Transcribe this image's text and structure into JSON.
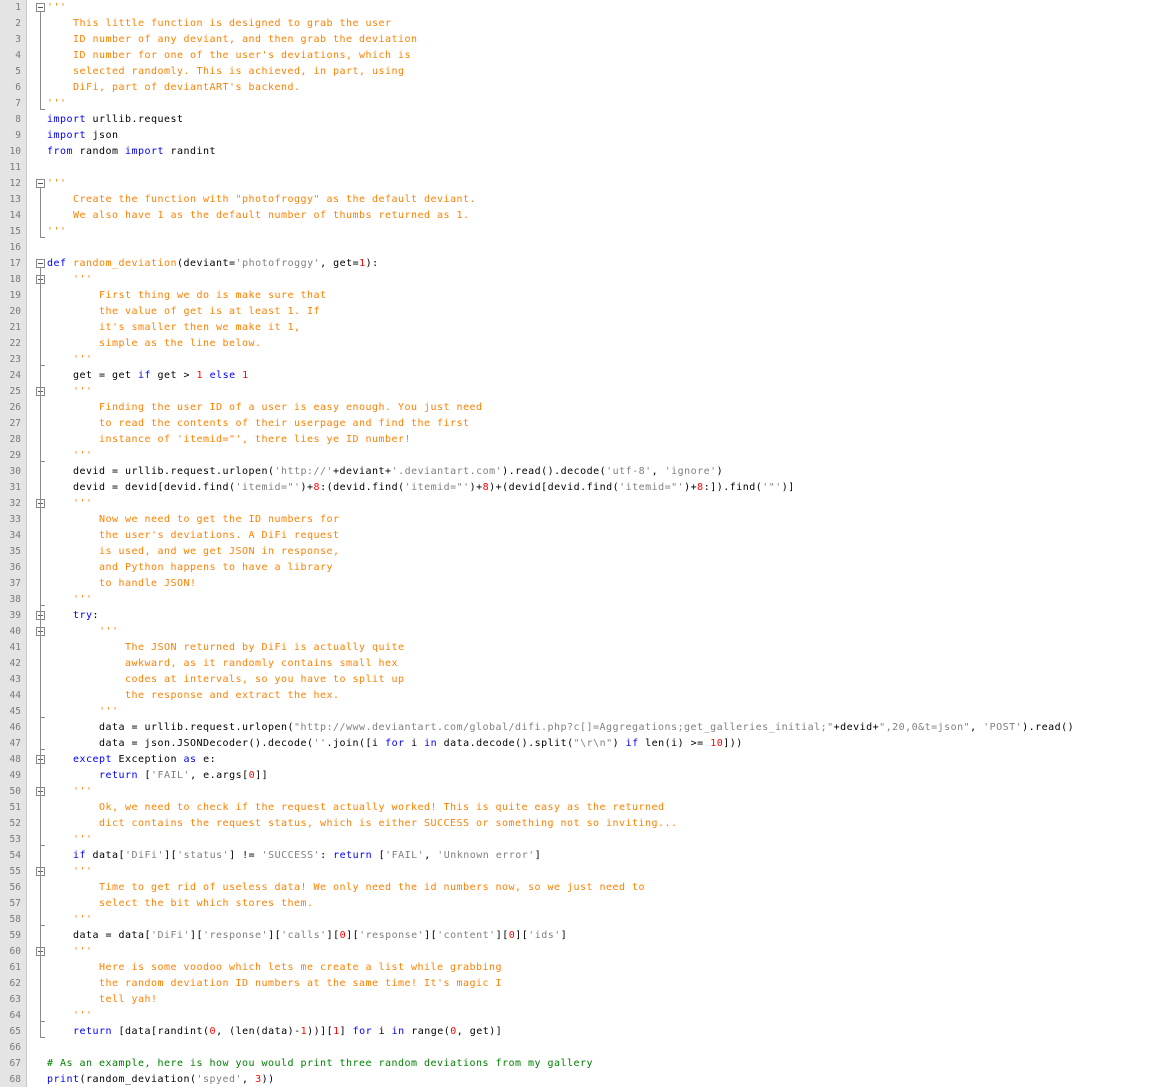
{
  "editor": {
    "colors": {
      "keyword": "#0000ff",
      "string": "#808080",
      "comment_string": "#ff8000",
      "number": "#ff0000",
      "comment": "#008000",
      "default": "#000000"
    },
    "lines": [
      {
        "n": "1",
        "t": [
          [
            "ds",
            "'''"
          ]
        ]
      },
      {
        "n": "2",
        "t": [
          [
            "ds",
            "    This little function is designed to grab the user"
          ]
        ]
      },
      {
        "n": "3",
        "t": [
          [
            "ds",
            "    ID number of any deviant, and then grab the deviation"
          ]
        ]
      },
      {
        "n": "4",
        "t": [
          [
            "ds",
            "    ID number for one of the user's deviations, which is"
          ]
        ]
      },
      {
        "n": "5",
        "t": [
          [
            "ds",
            "    selected randomly. This is achieved, in part, using"
          ]
        ]
      },
      {
        "n": "6",
        "t": [
          [
            "ds",
            "    DiFi, part of deviantART's backend."
          ]
        ]
      },
      {
        "n": "7",
        "t": [
          [
            "ds",
            "'''"
          ]
        ]
      },
      {
        "n": "8",
        "t": [
          [
            "kw",
            "import"
          ],
          [
            "d",
            " urllib.request"
          ]
        ]
      },
      {
        "n": "9",
        "t": [
          [
            "kw",
            "import"
          ],
          [
            "d",
            " json"
          ]
        ]
      },
      {
        "n": "10",
        "t": [
          [
            "kw",
            "from"
          ],
          [
            "d",
            " random "
          ],
          [
            "kw",
            "import"
          ],
          [
            "d",
            " randint"
          ]
        ]
      },
      {
        "n": "11",
        "t": []
      },
      {
        "n": "12",
        "t": [
          [
            "ds",
            "'''"
          ]
        ]
      },
      {
        "n": "13",
        "t": [
          [
            "ds",
            "    Create the function with \"photofroggy\" as the default deviant."
          ]
        ]
      },
      {
        "n": "14",
        "t": [
          [
            "ds",
            "    We also have 1 as the default number of thumbs returned as 1."
          ]
        ]
      },
      {
        "n": "15",
        "t": [
          [
            "ds",
            "'''"
          ]
        ]
      },
      {
        "n": "16",
        "t": []
      },
      {
        "n": "17",
        "t": [
          [
            "kw",
            "def"
          ],
          [
            "d",
            " "
          ],
          [
            "fn",
            "random_deviation"
          ],
          [
            "d",
            "(deviant="
          ],
          [
            "s",
            "'photofroggy'"
          ],
          [
            "d",
            ", get="
          ],
          [
            "num",
            "1"
          ],
          [
            "d",
            "):"
          ]
        ]
      },
      {
        "n": "18",
        "t": [
          [
            "d",
            "    "
          ],
          [
            "ds",
            "'''"
          ]
        ]
      },
      {
        "n": "19",
        "t": [
          [
            "ds",
            "        First thing we do is make sure that"
          ]
        ]
      },
      {
        "n": "20",
        "t": [
          [
            "ds",
            "        the value of get is at least 1. If"
          ]
        ]
      },
      {
        "n": "21",
        "t": [
          [
            "ds",
            "        it's smaller then we make it 1,"
          ]
        ]
      },
      {
        "n": "22",
        "t": [
          [
            "ds",
            "        simple as the line below."
          ]
        ]
      },
      {
        "n": "23",
        "t": [
          [
            "ds",
            "    '''"
          ]
        ]
      },
      {
        "n": "24",
        "t": [
          [
            "d",
            "    get = get "
          ],
          [
            "kw",
            "if"
          ],
          [
            "d",
            " get > "
          ],
          [
            "num",
            "1"
          ],
          [
            "d",
            " "
          ],
          [
            "kw",
            "else"
          ],
          [
            "d",
            " "
          ],
          [
            "num",
            "1"
          ]
        ]
      },
      {
        "n": "25",
        "t": [
          [
            "d",
            "    "
          ],
          [
            "ds",
            "'''"
          ]
        ]
      },
      {
        "n": "26",
        "t": [
          [
            "ds",
            "        Finding the user ID of a user is easy enough. You just need"
          ]
        ]
      },
      {
        "n": "27",
        "t": [
          [
            "ds",
            "        to read the contents of their userpage and find the first"
          ]
        ]
      },
      {
        "n": "28",
        "t": [
          [
            "ds",
            "        instance of 'itemid=\"', there lies ye ID number!"
          ]
        ]
      },
      {
        "n": "29",
        "t": [
          [
            "ds",
            "    '''"
          ]
        ]
      },
      {
        "n": "30",
        "t": [
          [
            "d",
            "    devid = urllib.request.urlopen("
          ],
          [
            "s",
            "'http://'"
          ],
          [
            "d",
            "+deviant+"
          ],
          [
            "s",
            "'.deviantart.com'"
          ],
          [
            "d",
            ").read().decode("
          ],
          [
            "s",
            "'utf-8'"
          ],
          [
            "d",
            ", "
          ],
          [
            "s",
            "'ignore'"
          ],
          [
            "d",
            ")"
          ]
        ]
      },
      {
        "n": "31",
        "t": [
          [
            "d",
            "    devid = devid[devid.find("
          ],
          [
            "s",
            "'itemid=\"'"
          ],
          [
            "d",
            ")+"
          ],
          [
            "num",
            "8"
          ],
          [
            "d",
            ":(devid.find("
          ],
          [
            "s",
            "'itemid=\"'"
          ],
          [
            "d",
            ")+"
          ],
          [
            "num",
            "8"
          ],
          [
            "d",
            ")+(devid[devid.find("
          ],
          [
            "s",
            "'itemid=\"'"
          ],
          [
            "d",
            ")+"
          ],
          [
            "num",
            "8"
          ],
          [
            "d",
            ":]).find("
          ],
          [
            "s",
            "'\"'"
          ],
          [
            "d",
            ")]"
          ]
        ]
      },
      {
        "n": "32",
        "t": [
          [
            "d",
            "    "
          ],
          [
            "ds",
            "'''"
          ]
        ]
      },
      {
        "n": "33",
        "t": [
          [
            "ds",
            "        Now we need to get the ID numbers for"
          ]
        ]
      },
      {
        "n": "34",
        "t": [
          [
            "ds",
            "        the user's deviations. A DiFi request"
          ]
        ]
      },
      {
        "n": "35",
        "t": [
          [
            "ds",
            "        is used, and we get JSON in response,"
          ]
        ]
      },
      {
        "n": "36",
        "t": [
          [
            "ds",
            "        and Python happens to have a library"
          ]
        ]
      },
      {
        "n": "37",
        "t": [
          [
            "ds",
            "        to handle JSON!"
          ]
        ]
      },
      {
        "n": "38",
        "t": [
          [
            "ds",
            "    '''"
          ]
        ]
      },
      {
        "n": "39",
        "t": [
          [
            "d",
            "    "
          ],
          [
            "kw",
            "try"
          ],
          [
            "d",
            ":"
          ]
        ]
      },
      {
        "n": "40",
        "t": [
          [
            "d",
            "        "
          ],
          [
            "ds",
            "'''"
          ]
        ]
      },
      {
        "n": "41",
        "t": [
          [
            "ds",
            "            The JSON returned by DiFi is actually quite"
          ]
        ]
      },
      {
        "n": "42",
        "t": [
          [
            "ds",
            "            awkward, as it randomly contains small hex"
          ]
        ]
      },
      {
        "n": "43",
        "t": [
          [
            "ds",
            "            codes at intervals, so you have to split up"
          ]
        ]
      },
      {
        "n": "44",
        "t": [
          [
            "ds",
            "            the response and extract the hex."
          ]
        ]
      },
      {
        "n": "45",
        "t": [
          [
            "ds",
            "        '''"
          ]
        ]
      },
      {
        "n": "46",
        "t": [
          [
            "d",
            "        data = urllib.request.urlopen("
          ],
          [
            "s",
            "\"http://www.deviantart.com/global/difi.php?c[]=Aggregations;get_galleries_initial;\""
          ],
          [
            "d",
            "+devid+"
          ],
          [
            "s",
            "\",20,0&t=json\""
          ],
          [
            "d",
            ", "
          ],
          [
            "s",
            "'POST'"
          ],
          [
            "d",
            ").read()"
          ]
        ]
      },
      {
        "n": "47",
        "t": [
          [
            "d",
            "        data = json.JSONDecoder().decode("
          ],
          [
            "s",
            "''"
          ],
          [
            "d",
            ".join([i "
          ],
          [
            "kw",
            "for"
          ],
          [
            "d",
            " i "
          ],
          [
            "kw",
            "in"
          ],
          [
            "d",
            " data.decode().split("
          ],
          [
            "s",
            "\"\\r\\n\""
          ],
          [
            "d",
            ") "
          ],
          [
            "kw",
            "if"
          ],
          [
            "d",
            " len(i) >= "
          ],
          [
            "num",
            "10"
          ],
          [
            "d",
            "]))"
          ]
        ]
      },
      {
        "n": "48",
        "t": [
          [
            "d",
            "    "
          ],
          [
            "kw",
            "except"
          ],
          [
            "d",
            " Exception "
          ],
          [
            "kw",
            "as"
          ],
          [
            "d",
            " e:"
          ]
        ]
      },
      {
        "n": "49",
        "t": [
          [
            "d",
            "        "
          ],
          [
            "kw",
            "return"
          ],
          [
            "d",
            " ["
          ],
          [
            "s",
            "'FAIL'"
          ],
          [
            "d",
            ", e.args["
          ],
          [
            "num",
            "0"
          ],
          [
            "d",
            "]]"
          ]
        ]
      },
      {
        "n": "50",
        "t": [
          [
            "d",
            "    "
          ],
          [
            "ds",
            "'''"
          ]
        ]
      },
      {
        "n": "51",
        "t": [
          [
            "ds",
            "        Ok, we need to check if the request actually worked! This is quite easy as the returned"
          ]
        ]
      },
      {
        "n": "52",
        "t": [
          [
            "ds",
            "        dict contains the request status, which is either SUCCESS or something not so inviting..."
          ]
        ]
      },
      {
        "n": "53",
        "t": [
          [
            "ds",
            "    '''"
          ]
        ]
      },
      {
        "n": "54",
        "t": [
          [
            "d",
            "    "
          ],
          [
            "kw",
            "if"
          ],
          [
            "d",
            " data["
          ],
          [
            "s",
            "'DiFi'"
          ],
          [
            "d",
            "]["
          ],
          [
            "s",
            "'status'"
          ],
          [
            "d",
            "] != "
          ],
          [
            "s",
            "'SUCCESS'"
          ],
          [
            "d",
            ": "
          ],
          [
            "kw",
            "return"
          ],
          [
            "d",
            " ["
          ],
          [
            "s",
            "'FAIL'"
          ],
          [
            "d",
            ", "
          ],
          [
            "s",
            "'Unknown error'"
          ],
          [
            "d",
            "]"
          ]
        ]
      },
      {
        "n": "55",
        "t": [
          [
            "d",
            "    "
          ],
          [
            "ds",
            "'''"
          ]
        ]
      },
      {
        "n": "56",
        "t": [
          [
            "ds",
            "        Time to get rid of useless data! We only need the id numbers now, so we just need to"
          ]
        ]
      },
      {
        "n": "57",
        "t": [
          [
            "ds",
            "        select the bit which stores them."
          ]
        ]
      },
      {
        "n": "58",
        "t": [
          [
            "ds",
            "    '''"
          ]
        ]
      },
      {
        "n": "59",
        "t": [
          [
            "d",
            "    data = data["
          ],
          [
            "s",
            "'DiFi'"
          ],
          [
            "d",
            "]["
          ],
          [
            "s",
            "'response'"
          ],
          [
            "d",
            "]["
          ],
          [
            "s",
            "'calls'"
          ],
          [
            "d",
            "]["
          ],
          [
            "num",
            "0"
          ],
          [
            "d",
            "]["
          ],
          [
            "s",
            "'response'"
          ],
          [
            "d",
            "]["
          ],
          [
            "s",
            "'content'"
          ],
          [
            "d",
            "]["
          ],
          [
            "num",
            "0"
          ],
          [
            "d",
            "]["
          ],
          [
            "s",
            "'ids'"
          ],
          [
            "d",
            "]"
          ]
        ]
      },
      {
        "n": "60",
        "t": [
          [
            "d",
            "    "
          ],
          [
            "ds",
            "'''"
          ]
        ]
      },
      {
        "n": "61",
        "t": [
          [
            "ds",
            "        Here is some voodoo which lets me create a list while grabbing"
          ]
        ]
      },
      {
        "n": "62",
        "t": [
          [
            "ds",
            "        the random deviation ID numbers at the same time! It's magic I"
          ]
        ]
      },
      {
        "n": "63",
        "t": [
          [
            "ds",
            "        tell yah!"
          ]
        ]
      },
      {
        "n": "64",
        "t": [
          [
            "ds",
            "    '''"
          ]
        ]
      },
      {
        "n": "65",
        "t": [
          [
            "d",
            "    "
          ],
          [
            "kw",
            "return"
          ],
          [
            "d",
            " [data[randint("
          ],
          [
            "num",
            "0"
          ],
          [
            "d",
            ", (len(data)-"
          ],
          [
            "num",
            "1"
          ],
          [
            "d",
            "))]["
          ],
          [
            "num",
            "1"
          ],
          [
            "d",
            "] "
          ],
          [
            "kw",
            "for"
          ],
          [
            "d",
            " i "
          ],
          [
            "kw",
            "in"
          ],
          [
            "d",
            " range("
          ],
          [
            "num",
            "0"
          ],
          [
            "d",
            ", get)]"
          ]
        ]
      },
      {
        "n": "66",
        "t": []
      },
      {
        "n": "67",
        "t": [
          [
            "cm",
            "# As an example, here is how you would print three random deviations from my gallery"
          ]
        ]
      },
      {
        "n": "68",
        "t": [
          [
            "fn2",
            "print"
          ],
          [
            "d",
            "(random_deviation("
          ],
          [
            "s",
            "'spyed'"
          ],
          [
            "d",
            ", "
          ],
          [
            "num",
            "3"
          ],
          [
            "d",
            "))"
          ]
        ]
      }
    ]
  }
}
